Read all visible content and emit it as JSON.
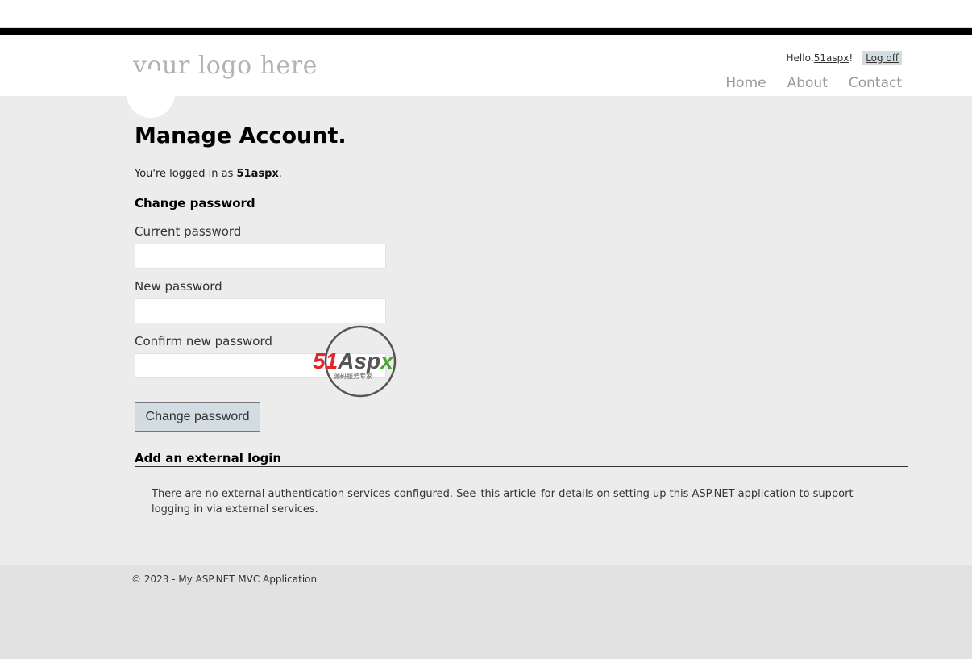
{
  "header": {
    "logo_text": "your logo here",
    "greeting_prefix": "Hello, ",
    "username": "51aspx",
    "greeting_suffix": "!",
    "logoff_label": "Log off",
    "nav": [
      "Home",
      "About",
      "Contact"
    ]
  },
  "main": {
    "title": "Manage Account.",
    "logged_in_prefix": "You're logged in as ",
    "logged_in_user": "51aspx",
    "logged_in_suffix": ".",
    "change_password_heading": "Change password",
    "fields": [
      {
        "label": "Current password",
        "value": ""
      },
      {
        "label": "New password",
        "value": ""
      },
      {
        "label": "Confirm new password",
        "value": ""
      }
    ],
    "submit_label": "Change password",
    "external_heading": "Add an external login",
    "external_text_before": "There are no external authentication services configured. See",
    "external_link": "this article",
    "external_text_after": "for details on setting up this ASP.NET application to support logging in via external services."
  },
  "footer": {
    "copyright": "© 2023 - My ASP.NET MVC Application"
  },
  "watermark": {
    "brand": "51Aspx",
    "brand_red": "51",
    "brand_dark": "Asp",
    "brand_green": "x",
    "tagline": "源码服务专家"
  },
  "colors": {
    "button_bg": "#d3dce0",
    "main_bg": "#ececec",
    "nav_text": "#999999",
    "logo_text": "#b3b3b3"
  }
}
